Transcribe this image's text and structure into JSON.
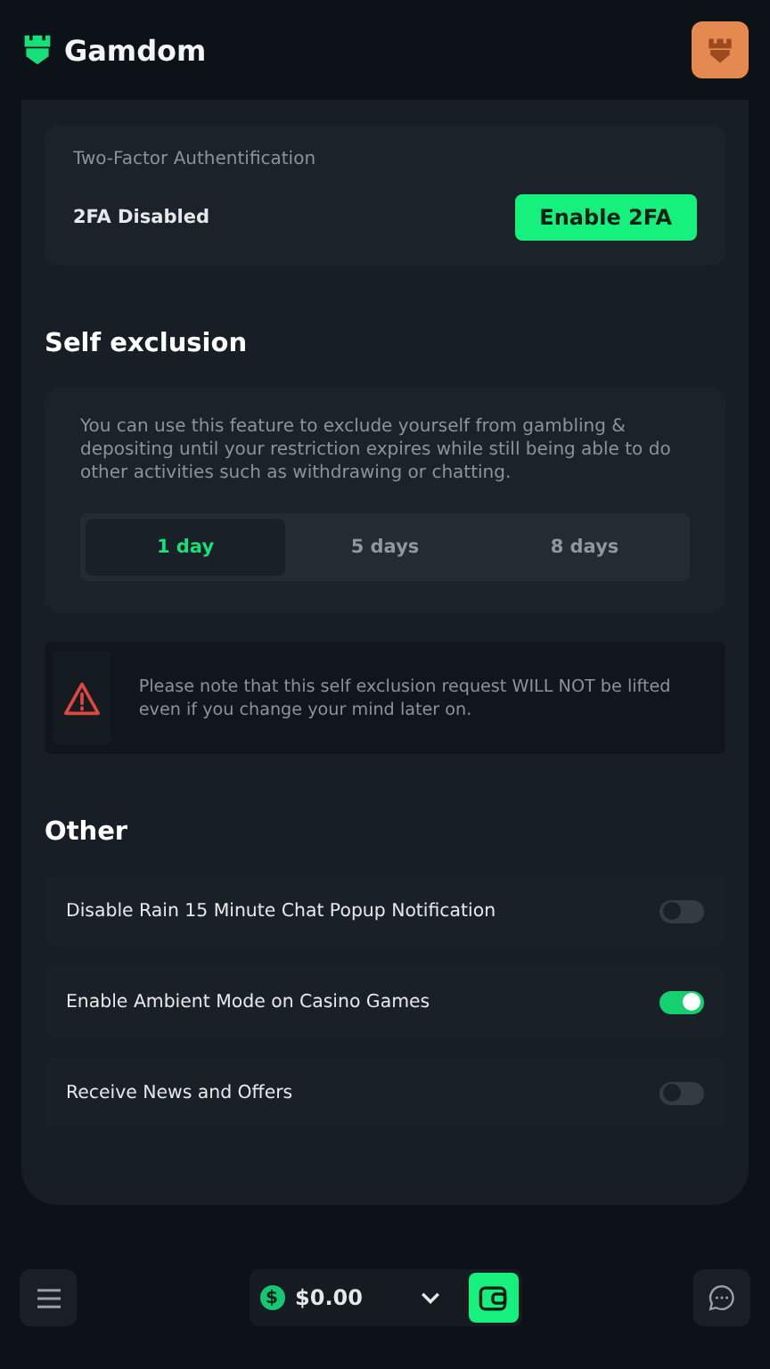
{
  "header": {
    "brand": "Gamdom"
  },
  "two_factor": {
    "title": "Two-Factor Authentification",
    "status": "2FA Disabled",
    "button": "Enable 2FA"
  },
  "self_exclusion": {
    "title": "Self exclusion",
    "description": "You can use this feature to exclude yourself from gambling & depositing until your restriction expires while still being able to do other activities such as withdrawing or chatting.",
    "options": [
      {
        "label": "1 day",
        "selected": true
      },
      {
        "label": "5 days",
        "selected": false
      },
      {
        "label": "8 days",
        "selected": false
      }
    ],
    "warning": "Please note that this self exclusion request WILL NOT be lifted even if you change your mind later on."
  },
  "other": {
    "title": "Other",
    "settings": [
      {
        "label": "Disable Rain 15 Minute Chat Popup Notification",
        "on": false
      },
      {
        "label": "Enable Ambient Mode on Casino Games",
        "on": true
      },
      {
        "label": "Receive News and Offers",
        "on": false
      }
    ]
  },
  "bottom_bar": {
    "coin_symbol": "$",
    "balance": "$0.00"
  }
}
